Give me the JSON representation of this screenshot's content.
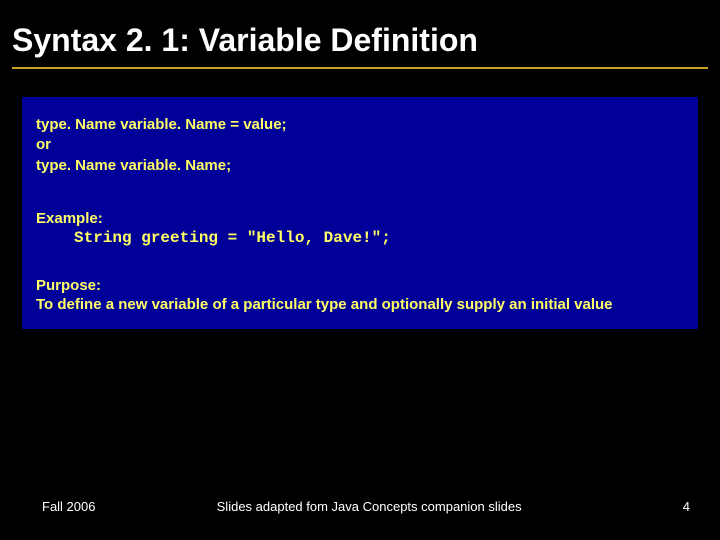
{
  "title": "Syntax 2. 1: Variable Definition",
  "syntax": "type. Name variable. Name = value;\nor\ntype. Name variable. Name;",
  "example": {
    "label": "Example:",
    "code": "String greeting = \"Hello, Dave!\";"
  },
  "purpose": {
    "label": "Purpose:",
    "text": "To define a new variable of a particular type and optionally supply an initial value"
  },
  "footer": {
    "left": "Fall 2006",
    "center": "Slides adapted fom Java Concepts companion slides",
    "page": "4"
  }
}
